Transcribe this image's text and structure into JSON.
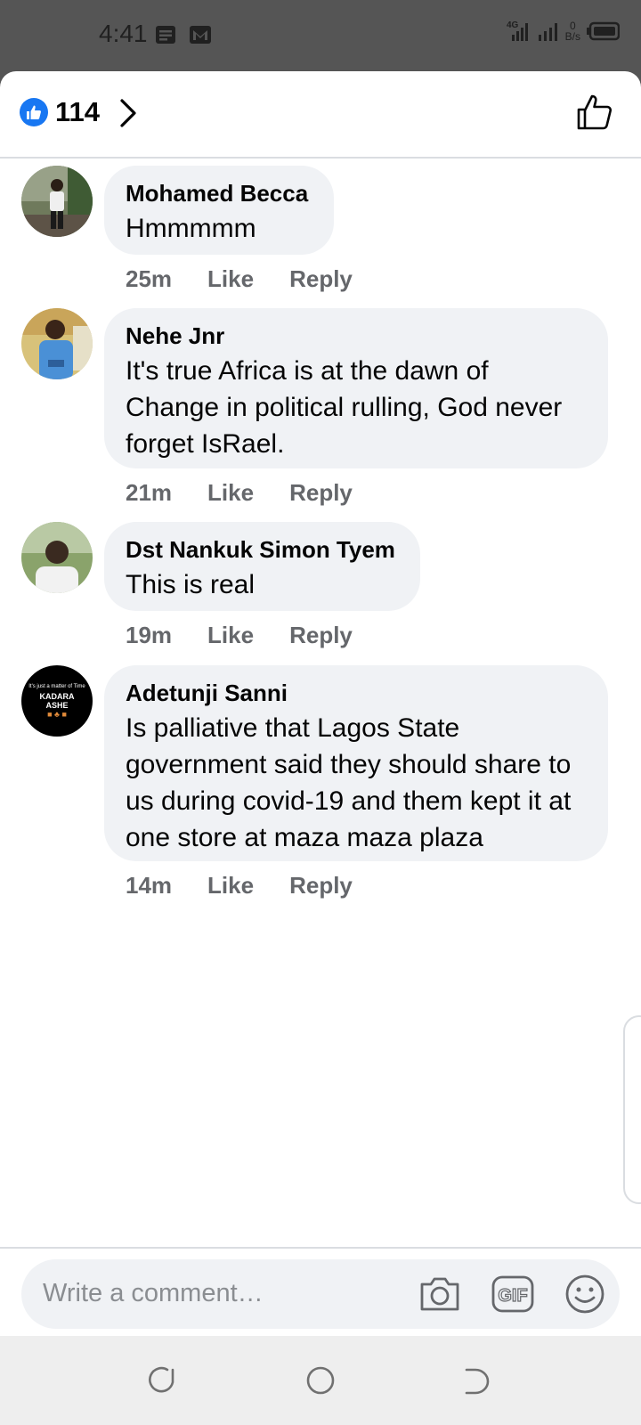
{
  "status_bar": {
    "time": "4:41",
    "network": "4G",
    "speed_value": "0",
    "speed_unit": "B/s",
    "icons": [
      "notes-icon",
      "gmail-icon",
      "signal-icon",
      "signal-icon",
      "battery-icon"
    ]
  },
  "header": {
    "reaction_icon": "like-icon",
    "reaction_count": "114"
  },
  "comments": [
    {
      "author": "Mohamed Becca",
      "text": "Hmmmmm",
      "time": "25m",
      "like": "Like",
      "reply": "Reply"
    },
    {
      "author": "Nehe Jnr",
      "text": "It's true Africa is at the dawn of Change  in political rulling, God never forget IsRael.",
      "time": "21m",
      "like": "Like",
      "reply": "Reply"
    },
    {
      "author": "Dst Nankuk Simon Tyem",
      "text": "This is real",
      "time": "19m",
      "like": "Like",
      "reply": "Reply"
    },
    {
      "author": "Adetunji Sanni",
      "text": "Is palliative that Lagos State government said they should share to us during covid-19 and them kept it at one store at maza maza plaza",
      "time": "14m",
      "like": "Like",
      "reply": "Reply"
    }
  ],
  "avatar4": {
    "line1": "It's just a matter of Time",
    "line2": "KADARA",
    "line3": "ASHE"
  },
  "composer": {
    "placeholder": "Write a comment…",
    "gif_label": "GIF"
  },
  "colors": {
    "accent": "#1877f2",
    "bubble": "#f0f2f5",
    "meta": "#65676b"
  }
}
